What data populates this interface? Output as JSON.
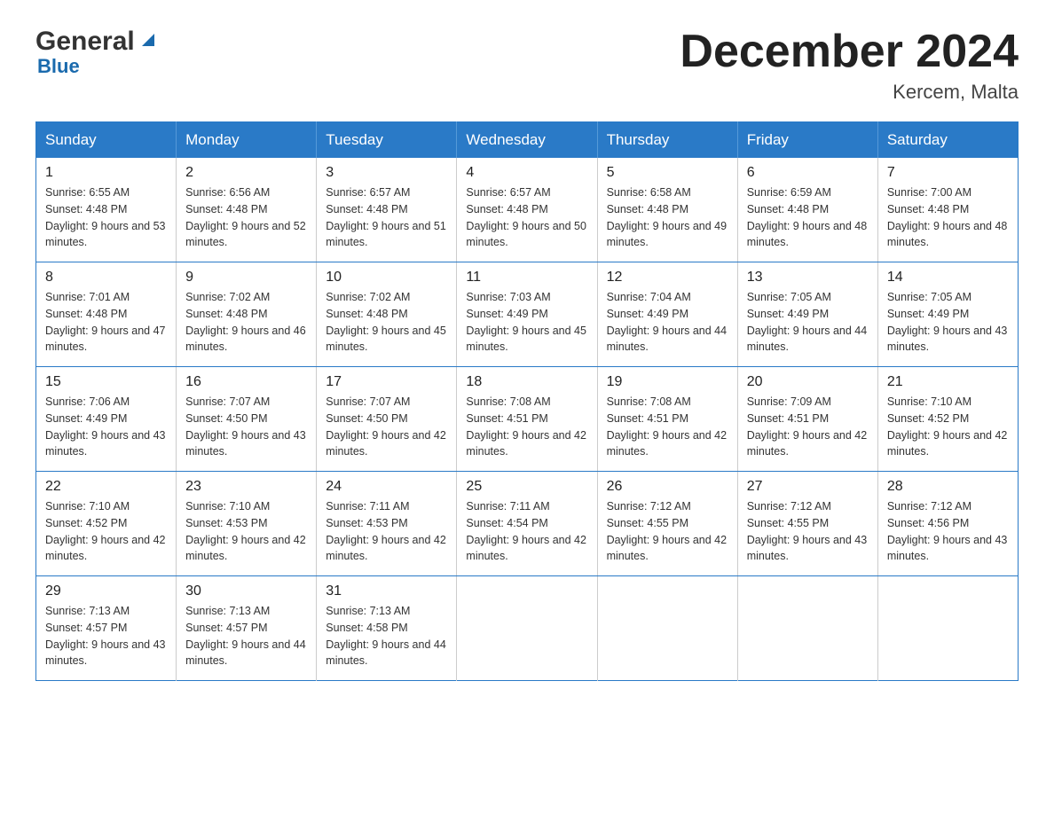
{
  "logo": {
    "general": "General",
    "blue": "Blue"
  },
  "title": "December 2024",
  "subtitle": "Kercem, Malta",
  "days": [
    "Sunday",
    "Monday",
    "Tuesday",
    "Wednesday",
    "Thursday",
    "Friday",
    "Saturday"
  ],
  "weeks": [
    [
      {
        "num": "1",
        "sunrise": "6:55 AM",
        "sunset": "4:48 PM",
        "daylight": "9 hours and 53 minutes."
      },
      {
        "num": "2",
        "sunrise": "6:56 AM",
        "sunset": "4:48 PM",
        "daylight": "9 hours and 52 minutes."
      },
      {
        "num": "3",
        "sunrise": "6:57 AM",
        "sunset": "4:48 PM",
        "daylight": "9 hours and 51 minutes."
      },
      {
        "num": "4",
        "sunrise": "6:57 AM",
        "sunset": "4:48 PM",
        "daylight": "9 hours and 50 minutes."
      },
      {
        "num": "5",
        "sunrise": "6:58 AM",
        "sunset": "4:48 PM",
        "daylight": "9 hours and 49 minutes."
      },
      {
        "num": "6",
        "sunrise": "6:59 AM",
        "sunset": "4:48 PM",
        "daylight": "9 hours and 48 minutes."
      },
      {
        "num": "7",
        "sunrise": "7:00 AM",
        "sunset": "4:48 PM",
        "daylight": "9 hours and 48 minutes."
      }
    ],
    [
      {
        "num": "8",
        "sunrise": "7:01 AM",
        "sunset": "4:48 PM",
        "daylight": "9 hours and 47 minutes."
      },
      {
        "num": "9",
        "sunrise": "7:02 AM",
        "sunset": "4:48 PM",
        "daylight": "9 hours and 46 minutes."
      },
      {
        "num": "10",
        "sunrise": "7:02 AM",
        "sunset": "4:48 PM",
        "daylight": "9 hours and 45 minutes."
      },
      {
        "num": "11",
        "sunrise": "7:03 AM",
        "sunset": "4:49 PM",
        "daylight": "9 hours and 45 minutes."
      },
      {
        "num": "12",
        "sunrise": "7:04 AM",
        "sunset": "4:49 PM",
        "daylight": "9 hours and 44 minutes."
      },
      {
        "num": "13",
        "sunrise": "7:05 AM",
        "sunset": "4:49 PM",
        "daylight": "9 hours and 44 minutes."
      },
      {
        "num": "14",
        "sunrise": "7:05 AM",
        "sunset": "4:49 PM",
        "daylight": "9 hours and 43 minutes."
      }
    ],
    [
      {
        "num": "15",
        "sunrise": "7:06 AM",
        "sunset": "4:49 PM",
        "daylight": "9 hours and 43 minutes."
      },
      {
        "num": "16",
        "sunrise": "7:07 AM",
        "sunset": "4:50 PM",
        "daylight": "9 hours and 43 minutes."
      },
      {
        "num": "17",
        "sunrise": "7:07 AM",
        "sunset": "4:50 PM",
        "daylight": "9 hours and 42 minutes."
      },
      {
        "num": "18",
        "sunrise": "7:08 AM",
        "sunset": "4:51 PM",
        "daylight": "9 hours and 42 minutes."
      },
      {
        "num": "19",
        "sunrise": "7:08 AM",
        "sunset": "4:51 PM",
        "daylight": "9 hours and 42 minutes."
      },
      {
        "num": "20",
        "sunrise": "7:09 AM",
        "sunset": "4:51 PM",
        "daylight": "9 hours and 42 minutes."
      },
      {
        "num": "21",
        "sunrise": "7:10 AM",
        "sunset": "4:52 PM",
        "daylight": "9 hours and 42 minutes."
      }
    ],
    [
      {
        "num": "22",
        "sunrise": "7:10 AM",
        "sunset": "4:52 PM",
        "daylight": "9 hours and 42 minutes."
      },
      {
        "num": "23",
        "sunrise": "7:10 AM",
        "sunset": "4:53 PM",
        "daylight": "9 hours and 42 minutes."
      },
      {
        "num": "24",
        "sunrise": "7:11 AM",
        "sunset": "4:53 PM",
        "daylight": "9 hours and 42 minutes."
      },
      {
        "num": "25",
        "sunrise": "7:11 AM",
        "sunset": "4:54 PM",
        "daylight": "9 hours and 42 minutes."
      },
      {
        "num": "26",
        "sunrise": "7:12 AM",
        "sunset": "4:55 PM",
        "daylight": "9 hours and 42 minutes."
      },
      {
        "num": "27",
        "sunrise": "7:12 AM",
        "sunset": "4:55 PM",
        "daylight": "9 hours and 43 minutes."
      },
      {
        "num": "28",
        "sunrise": "7:12 AM",
        "sunset": "4:56 PM",
        "daylight": "9 hours and 43 minutes."
      }
    ],
    [
      {
        "num": "29",
        "sunrise": "7:13 AM",
        "sunset": "4:57 PM",
        "daylight": "9 hours and 43 minutes."
      },
      {
        "num": "30",
        "sunrise": "7:13 AM",
        "sunset": "4:57 PM",
        "daylight": "9 hours and 44 minutes."
      },
      {
        "num": "31",
        "sunrise": "7:13 AM",
        "sunset": "4:58 PM",
        "daylight": "9 hours and 44 minutes."
      },
      null,
      null,
      null,
      null
    ]
  ]
}
